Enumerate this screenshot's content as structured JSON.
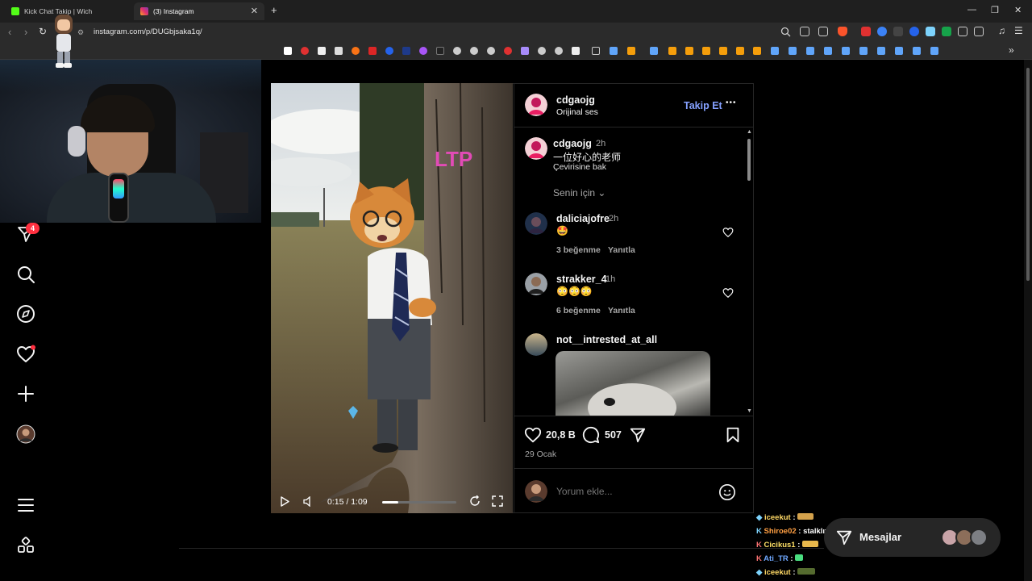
{
  "browser": {
    "tabs": [
      {
        "label": "Kick Chat Takip | Wich",
        "favicon_color": "#53fc18"
      },
      {
        "label": "(3) Instagram",
        "favicon_color": "#e1306c"
      }
    ],
    "new_tab_symbol": "+",
    "url": "instagram.com/p/DUGbjsaka1q/"
  },
  "sidebar": {
    "notification_count": "4",
    "items": [
      {
        "icon": "send-icon"
      },
      {
        "icon": "search-icon"
      },
      {
        "icon": "explore-compass-icon"
      },
      {
        "icon": "notifications-heart-icon"
      },
      {
        "icon": "create-plus-icon"
      },
      {
        "icon": "profile-avatar"
      },
      {
        "icon": "menu-icon"
      },
      {
        "icon": "more-apps-icon"
      }
    ]
  },
  "post": {
    "author": "cdgaojg",
    "audio": "Orijinal ses",
    "follow_label": "Takip Et",
    "more_symbol": "•••",
    "caption": {
      "author": "cdgaojg",
      "time": "2h",
      "text": "一位好心的老师",
      "translate": "Çevirisine bak"
    },
    "sort_label": "Senin için",
    "comments": [
      {
        "user": "daliciajofre",
        "time": "2h",
        "text": "🤩",
        "likes": "3 beğenme",
        "reply": "Yanıtla"
      },
      {
        "user": "strakker_4",
        "time": "1h",
        "text": "😳😳😳",
        "likes": "6 beğenme",
        "reply": "Yanıtla"
      },
      {
        "user": "not__intrested_at_all",
        "time": "",
        "text": ""
      }
    ],
    "like_count": "20,8 B",
    "comment_count": "507",
    "date": "29 Ocak",
    "comment_placeholder": "Yorum ekle...",
    "video": {
      "time": "0:15 / 1:09",
      "progress": 0.22,
      "watermark": "LTP"
    }
  },
  "chat": [
    {
      "user": "iceekut",
      "msg": "",
      "color": "#ffd966"
    },
    {
      "user": "Shiroe02",
      "msg": "stalklıyor",
      "color": "#ff9f43"
    },
    {
      "user": "Cicikus1",
      "msg": "",
      "color": "#ffe066"
    },
    {
      "user": "Ati_TR",
      "msg": "",
      "color": "#6fa8ff"
    },
    {
      "user": "iceekut",
      "msg": "",
      "color": "#ffd966"
    }
  ],
  "messages_label": "Mesajlar",
  "colors": {
    "accent_link": "#85a1ff",
    "badge_red": "#ff3040",
    "background": "#000000"
  }
}
